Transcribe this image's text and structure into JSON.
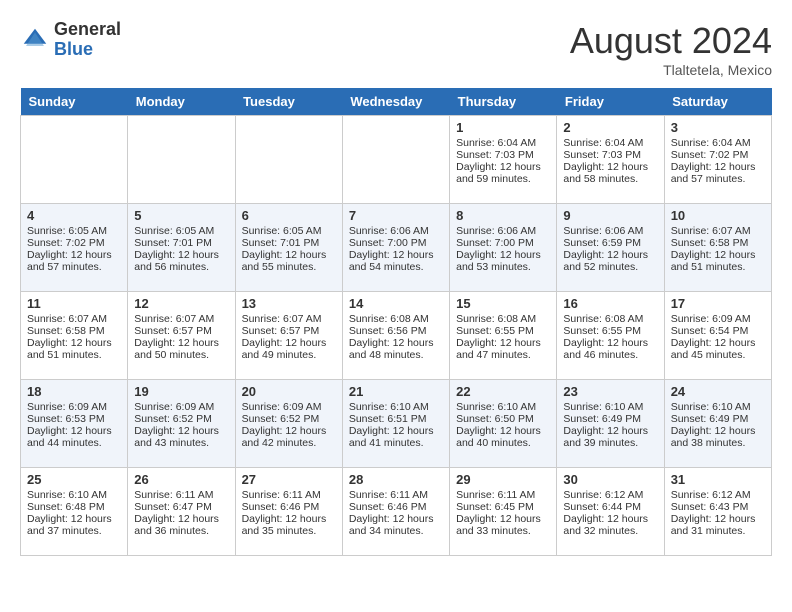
{
  "header": {
    "logo_general": "General",
    "logo_blue": "Blue",
    "month_title": "August 2024",
    "location": "Tlaltetela, Mexico"
  },
  "days_of_week": [
    "Sunday",
    "Monday",
    "Tuesday",
    "Wednesday",
    "Thursday",
    "Friday",
    "Saturday"
  ],
  "weeks": [
    [
      {
        "day": "",
        "sunrise": "",
        "sunset": "",
        "daylight": ""
      },
      {
        "day": "",
        "sunrise": "",
        "sunset": "",
        "daylight": ""
      },
      {
        "day": "",
        "sunrise": "",
        "sunset": "",
        "daylight": ""
      },
      {
        "day": "",
        "sunrise": "",
        "sunset": "",
        "daylight": ""
      },
      {
        "day": "1",
        "sunrise": "Sunrise: 6:04 AM",
        "sunset": "Sunset: 7:03 PM",
        "daylight": "Daylight: 12 hours and 59 minutes."
      },
      {
        "day": "2",
        "sunrise": "Sunrise: 6:04 AM",
        "sunset": "Sunset: 7:03 PM",
        "daylight": "Daylight: 12 hours and 58 minutes."
      },
      {
        "day": "3",
        "sunrise": "Sunrise: 6:04 AM",
        "sunset": "Sunset: 7:02 PM",
        "daylight": "Daylight: 12 hours and 57 minutes."
      }
    ],
    [
      {
        "day": "4",
        "sunrise": "Sunrise: 6:05 AM",
        "sunset": "Sunset: 7:02 PM",
        "daylight": "Daylight: 12 hours and 57 minutes."
      },
      {
        "day": "5",
        "sunrise": "Sunrise: 6:05 AM",
        "sunset": "Sunset: 7:01 PM",
        "daylight": "Daylight: 12 hours and 56 minutes."
      },
      {
        "day": "6",
        "sunrise": "Sunrise: 6:05 AM",
        "sunset": "Sunset: 7:01 PM",
        "daylight": "Daylight: 12 hours and 55 minutes."
      },
      {
        "day": "7",
        "sunrise": "Sunrise: 6:06 AM",
        "sunset": "Sunset: 7:00 PM",
        "daylight": "Daylight: 12 hours and 54 minutes."
      },
      {
        "day": "8",
        "sunrise": "Sunrise: 6:06 AM",
        "sunset": "Sunset: 7:00 PM",
        "daylight": "Daylight: 12 hours and 53 minutes."
      },
      {
        "day": "9",
        "sunrise": "Sunrise: 6:06 AM",
        "sunset": "Sunset: 6:59 PM",
        "daylight": "Daylight: 12 hours and 52 minutes."
      },
      {
        "day": "10",
        "sunrise": "Sunrise: 6:07 AM",
        "sunset": "Sunset: 6:58 PM",
        "daylight": "Daylight: 12 hours and 51 minutes."
      }
    ],
    [
      {
        "day": "11",
        "sunrise": "Sunrise: 6:07 AM",
        "sunset": "Sunset: 6:58 PM",
        "daylight": "Daylight: 12 hours and 51 minutes."
      },
      {
        "day": "12",
        "sunrise": "Sunrise: 6:07 AM",
        "sunset": "Sunset: 6:57 PM",
        "daylight": "Daylight: 12 hours and 50 minutes."
      },
      {
        "day": "13",
        "sunrise": "Sunrise: 6:07 AM",
        "sunset": "Sunset: 6:57 PM",
        "daylight": "Daylight: 12 hours and 49 minutes."
      },
      {
        "day": "14",
        "sunrise": "Sunrise: 6:08 AM",
        "sunset": "Sunset: 6:56 PM",
        "daylight": "Daylight: 12 hours and 48 minutes."
      },
      {
        "day": "15",
        "sunrise": "Sunrise: 6:08 AM",
        "sunset": "Sunset: 6:55 PM",
        "daylight": "Daylight: 12 hours and 47 minutes."
      },
      {
        "day": "16",
        "sunrise": "Sunrise: 6:08 AM",
        "sunset": "Sunset: 6:55 PM",
        "daylight": "Daylight: 12 hours and 46 minutes."
      },
      {
        "day": "17",
        "sunrise": "Sunrise: 6:09 AM",
        "sunset": "Sunset: 6:54 PM",
        "daylight": "Daylight: 12 hours and 45 minutes."
      }
    ],
    [
      {
        "day": "18",
        "sunrise": "Sunrise: 6:09 AM",
        "sunset": "Sunset: 6:53 PM",
        "daylight": "Daylight: 12 hours and 44 minutes."
      },
      {
        "day": "19",
        "sunrise": "Sunrise: 6:09 AM",
        "sunset": "Sunset: 6:52 PM",
        "daylight": "Daylight: 12 hours and 43 minutes."
      },
      {
        "day": "20",
        "sunrise": "Sunrise: 6:09 AM",
        "sunset": "Sunset: 6:52 PM",
        "daylight": "Daylight: 12 hours and 42 minutes."
      },
      {
        "day": "21",
        "sunrise": "Sunrise: 6:10 AM",
        "sunset": "Sunset: 6:51 PM",
        "daylight": "Daylight: 12 hours and 41 minutes."
      },
      {
        "day": "22",
        "sunrise": "Sunrise: 6:10 AM",
        "sunset": "Sunset: 6:50 PM",
        "daylight": "Daylight: 12 hours and 40 minutes."
      },
      {
        "day": "23",
        "sunrise": "Sunrise: 6:10 AM",
        "sunset": "Sunset: 6:49 PM",
        "daylight": "Daylight: 12 hours and 39 minutes."
      },
      {
        "day": "24",
        "sunrise": "Sunrise: 6:10 AM",
        "sunset": "Sunset: 6:49 PM",
        "daylight": "Daylight: 12 hours and 38 minutes."
      }
    ],
    [
      {
        "day": "25",
        "sunrise": "Sunrise: 6:10 AM",
        "sunset": "Sunset: 6:48 PM",
        "daylight": "Daylight: 12 hours and 37 minutes."
      },
      {
        "day": "26",
        "sunrise": "Sunrise: 6:11 AM",
        "sunset": "Sunset: 6:47 PM",
        "daylight": "Daylight: 12 hours and 36 minutes."
      },
      {
        "day": "27",
        "sunrise": "Sunrise: 6:11 AM",
        "sunset": "Sunset: 6:46 PM",
        "daylight": "Daylight: 12 hours and 35 minutes."
      },
      {
        "day": "28",
        "sunrise": "Sunrise: 6:11 AM",
        "sunset": "Sunset: 6:46 PM",
        "daylight": "Daylight: 12 hours and 34 minutes."
      },
      {
        "day": "29",
        "sunrise": "Sunrise: 6:11 AM",
        "sunset": "Sunset: 6:45 PM",
        "daylight": "Daylight: 12 hours and 33 minutes."
      },
      {
        "day": "30",
        "sunrise": "Sunrise: 6:12 AM",
        "sunset": "Sunset: 6:44 PM",
        "daylight": "Daylight: 12 hours and 32 minutes."
      },
      {
        "day": "31",
        "sunrise": "Sunrise: 6:12 AM",
        "sunset": "Sunset: 6:43 PM",
        "daylight": "Daylight: 12 hours and 31 minutes."
      }
    ]
  ]
}
